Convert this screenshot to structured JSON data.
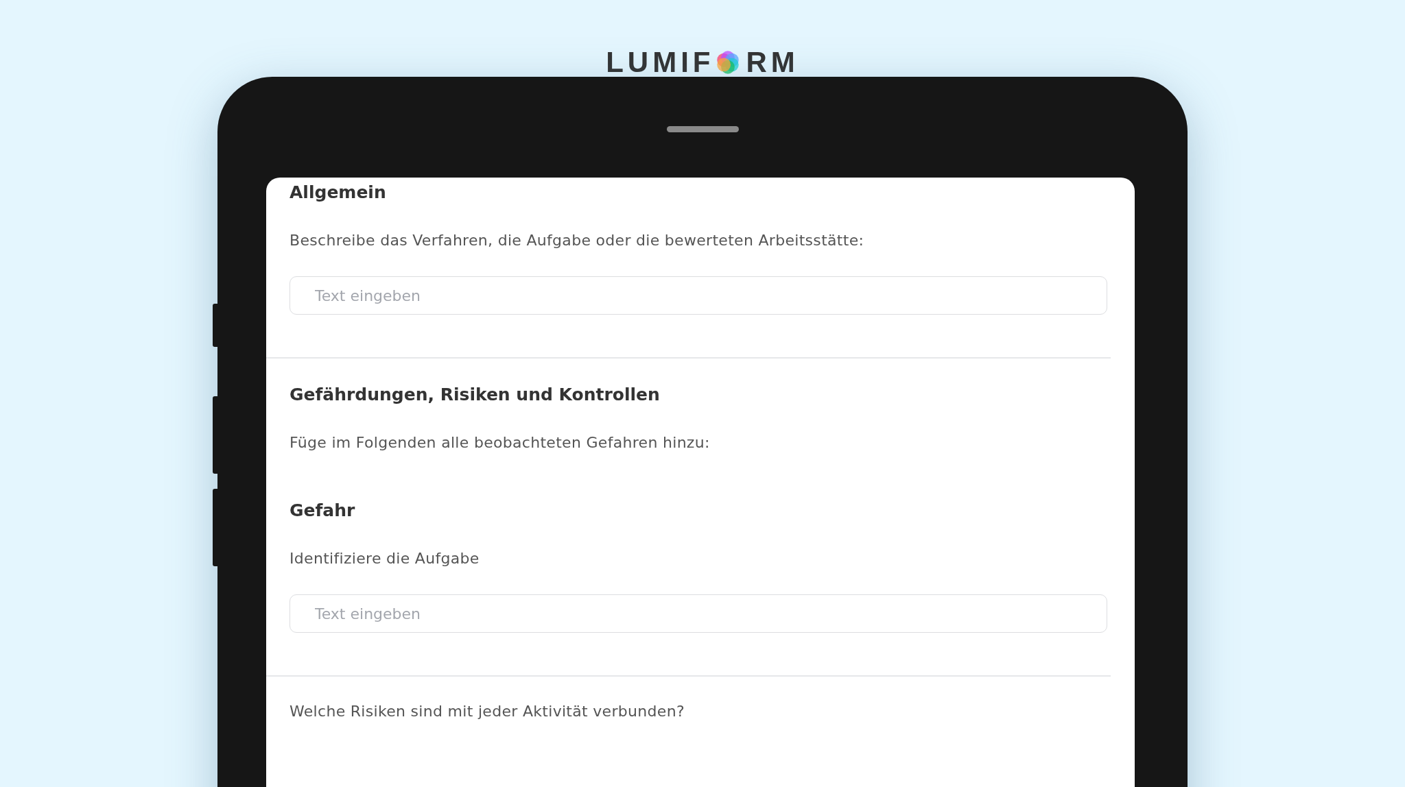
{
  "logo": {
    "before": "LUMIF",
    "after": "RM"
  },
  "form": {
    "items": [
      {
        "kind": "heading",
        "text": "Allgemein"
      },
      {
        "kind": "text",
        "text": "Beschreibe das Verfahren, die Aufgabe oder die bewerteten Arbeitsstätte:"
      },
      {
        "kind": "input",
        "placeholder": "Text eingeben"
      },
      {
        "kind": "divider"
      },
      {
        "kind": "heading",
        "text": "Gefährdungen, Risiken und Kontrollen"
      },
      {
        "kind": "text",
        "text": "Füge im Folgenden alle beobachteten Gefahren hinzu:"
      },
      {
        "kind": "heading",
        "text": "Gefahr"
      },
      {
        "kind": "text",
        "text": "Identifiziere die Aufgabe"
      },
      {
        "kind": "input",
        "placeholder": "Text eingeben"
      },
      {
        "kind": "divider"
      },
      {
        "kind": "text",
        "text": "Welche Risiken sind mit jeder Aktivität verbunden?"
      }
    ]
  }
}
